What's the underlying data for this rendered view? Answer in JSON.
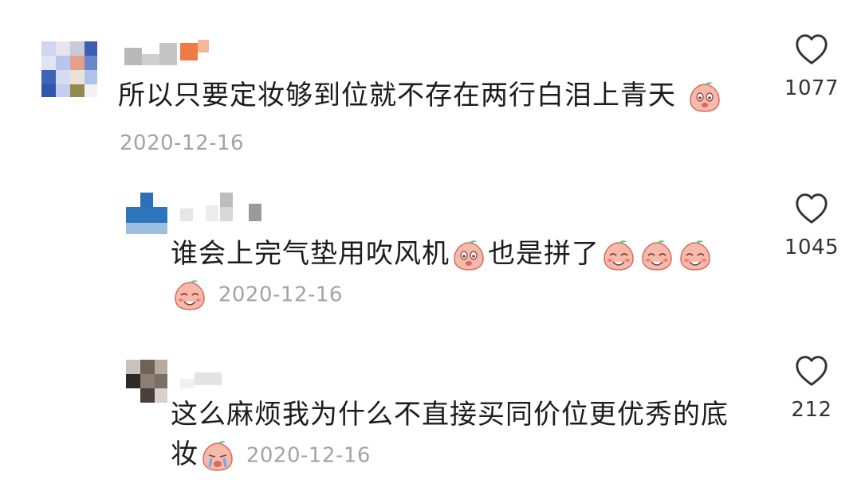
{
  "comments": [
    {
      "text": "所以只要定妆够到位就不存在两行白泪上青天",
      "emojis": [
        "peach-surprised-emoji"
      ],
      "date": "2020-12-16",
      "likes": "1077"
    },
    {
      "text_before": "谁会上完气垫用吹风机",
      "text_after": "也是拼了",
      "emojis_inline": [
        "peach-surprised-emoji"
      ],
      "emojis_end": [
        "peach-laughing-emoji",
        "peach-laughing-emoji",
        "peach-laughing-emoji",
        "peach-laughing-emoji"
      ],
      "date": "2020-12-16",
      "likes": "1045"
    },
    {
      "text": "这么麻烦我为什么不直接买同价位更优秀的底妆",
      "emojis": [
        "peach-crying-emoji"
      ],
      "date": "2020-12-16",
      "likes": "212"
    }
  ],
  "icons": {
    "like": "heart-outline-icon"
  },
  "colors": {
    "date": "#a3a3a3",
    "text": "#1c1c1c",
    "peach": "#f6b0a4"
  }
}
